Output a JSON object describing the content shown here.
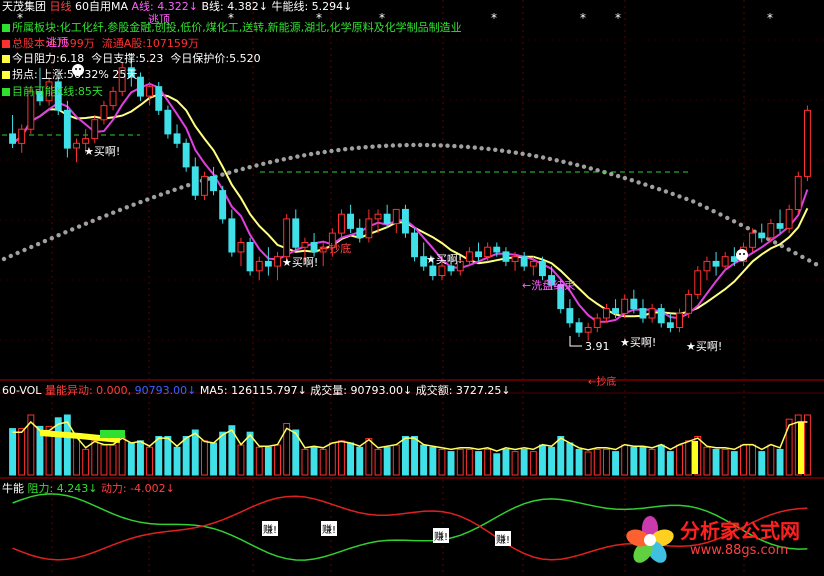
{
  "header": {
    "stock": "天茂集团",
    "period": "日线",
    "indicator": "60自用MA",
    "a_label": "A线:",
    "a_value": "4.322↓",
    "b_label": "B线:",
    "b_value": "4.382↓",
    "n_label": "牛能线:",
    "n_value": "5.294↓"
  },
  "info": {
    "sector": "所属板块:化工化纤,参股金融,创投,低价,煤化工,送转,新能源,湖北,化学原料及化学制品制造业",
    "total_cap": "总股本:47599万",
    "float_cap": "流通A股:107159万",
    "resist": "今日阻力:6.18",
    "support": "今日支撑:5.23",
    "protect": "今日保护价:5.520",
    "pivot": "拐点:",
    "up_pct": "上涨:56.32%",
    "days1": "25天",
    "cycle": "目前可能K线:85天"
  },
  "annotations": {
    "top1": "逃顶",
    "top2": "逃顶",
    "buy": "★买啊!",
    "bottom": "←抄底",
    "wash": "←洗盘结束",
    "low": "3.91",
    "bottom2": "←抄底"
  },
  "vol_header": {
    "name": "60-VOL",
    "abn_label": "量能异动:",
    "abn_value": "0.000,",
    "abn_value2": "90793.00↓",
    "ma5": "MA5: 126115.797↓",
    "volume": "成交量: 90793.00↓",
    "amount": "成交额: 3727.25↓"
  },
  "niu_header": {
    "name": "牛能",
    "resist_label": "阻力:",
    "resist_value": "4.243↓",
    "power_label": "动力:",
    "power_value": "-4.002↓",
    "earn": "赚!"
  },
  "logo": {
    "name": "分析家公式网",
    "url": "www.88gs.com"
  },
  "colors": {
    "up": "#ff3030",
    "down": "#40e0e8",
    "ma_a": "#ffff80",
    "ma_b": "#e040e0",
    "dots": "#a0a0a0",
    "green": "#30d030",
    "red": "#e02020"
  },
  "chart_data": {
    "type": "candlestick",
    "price_ylim": [
      3.6,
      7.2
    ],
    "candles": [
      [
        6.1,
        6.3,
        5.95,
        6.0
      ],
      [
        6.0,
        6.2,
        5.9,
        6.15
      ],
      [
        6.15,
        6.6,
        6.1,
        6.55
      ],
      [
        6.55,
        6.8,
        6.4,
        6.45
      ],
      [
        6.45,
        6.7,
        6.4,
        6.65
      ],
      [
        6.65,
        6.7,
        6.3,
        6.35
      ],
      [
        6.35,
        6.45,
        5.85,
        5.95
      ],
      [
        5.95,
        6.05,
        5.8,
        6.0
      ],
      [
        6.0,
        6.15,
        5.9,
        6.05
      ],
      [
        6.05,
        6.3,
        6.0,
        6.25
      ],
      [
        6.25,
        6.45,
        6.2,
        6.4
      ],
      [
        6.4,
        6.6,
        6.35,
        6.55
      ],
      [
        6.55,
        6.85,
        6.5,
        6.8
      ],
      [
        6.8,
        6.95,
        6.6,
        6.7
      ],
      [
        6.7,
        6.75,
        6.45,
        6.5
      ],
      [
        6.5,
        6.65,
        6.4,
        6.6
      ],
      [
        6.6,
        6.65,
        6.3,
        6.35
      ],
      [
        6.35,
        6.4,
        6.05,
        6.1
      ],
      [
        6.1,
        6.2,
        5.95,
        6.0
      ],
      [
        6.0,
        6.05,
        5.7,
        5.75
      ],
      [
        5.75,
        5.85,
        5.4,
        5.45
      ],
      [
        5.45,
        5.7,
        5.4,
        5.65
      ],
      [
        5.65,
        5.75,
        5.45,
        5.5
      ],
      [
        5.5,
        5.55,
        5.15,
        5.2
      ],
      [
        5.2,
        5.3,
        4.8,
        4.85
      ],
      [
        4.85,
        5.0,
        4.7,
        4.95
      ],
      [
        4.95,
        5.0,
        4.6,
        4.65
      ],
      [
        4.65,
        4.8,
        4.55,
        4.75
      ],
      [
        4.75,
        4.9,
        4.6,
        4.7
      ],
      [
        4.7,
        4.85,
        4.55,
        4.8
      ],
      [
        4.8,
        5.25,
        4.75,
        5.2
      ],
      [
        5.2,
        5.3,
        4.85,
        4.9
      ],
      [
        4.9,
        5.0,
        4.75,
        4.95
      ],
      [
        4.95,
        5.05,
        4.8,
        4.85
      ],
      [
        4.85,
        4.95,
        4.7,
        4.9
      ],
      [
        4.9,
        5.1,
        4.8,
        5.05
      ],
      [
        5.05,
        5.3,
        5.0,
        5.25
      ],
      [
        5.25,
        5.35,
        5.05,
        5.1
      ],
      [
        5.1,
        5.2,
        4.95,
        5.0
      ],
      [
        5.0,
        5.3,
        4.95,
        5.2
      ],
      [
        5.2,
        5.3,
        5.05,
        5.25
      ],
      [
        5.25,
        5.35,
        5.1,
        5.15
      ],
      [
        5.15,
        5.3,
        5.05,
        5.3
      ],
      [
        5.3,
        5.35,
        5.0,
        5.05
      ],
      [
        5.05,
        5.1,
        4.75,
        4.8
      ],
      [
        4.8,
        4.95,
        4.65,
        4.7
      ],
      [
        4.7,
        4.8,
        4.55,
        4.6
      ],
      [
        4.6,
        4.75,
        4.55,
        4.7
      ],
      [
        4.7,
        4.8,
        4.6,
        4.65
      ],
      [
        4.65,
        4.8,
        4.6,
        4.75
      ],
      [
        4.75,
        4.9,
        4.7,
        4.85
      ],
      [
        4.85,
        4.95,
        4.75,
        4.8
      ],
      [
        4.8,
        4.95,
        4.75,
        4.9
      ],
      [
        4.9,
        4.95,
        4.8,
        4.85
      ],
      [
        4.85,
        4.9,
        4.7,
        4.75
      ],
      [
        4.75,
        4.85,
        4.65,
        4.8
      ],
      [
        4.8,
        4.85,
        4.65,
        4.7
      ],
      [
        4.7,
        4.8,
        4.6,
        4.75
      ],
      [
        4.75,
        4.8,
        4.55,
        4.6
      ],
      [
        4.6,
        4.7,
        4.45,
        4.5
      ],
      [
        4.5,
        4.55,
        4.2,
        4.25
      ],
      [
        4.25,
        4.35,
        4.05,
        4.1
      ],
      [
        4.1,
        4.15,
        3.95,
        4.0
      ],
      [
        4.0,
        4.1,
        3.91,
        4.05
      ],
      [
        4.05,
        4.2,
        4.0,
        4.15
      ],
      [
        4.15,
        4.3,
        4.1,
        4.25
      ],
      [
        4.25,
        4.35,
        4.15,
        4.2
      ],
      [
        4.2,
        4.4,
        4.15,
        4.35
      ],
      [
        4.35,
        4.45,
        4.2,
        4.25
      ],
      [
        4.25,
        4.35,
        4.1,
        4.15
      ],
      [
        4.15,
        4.3,
        4.1,
        4.25
      ],
      [
        4.25,
        4.3,
        4.05,
        4.1
      ],
      [
        4.1,
        4.2,
        4.0,
        4.05
      ],
      [
        4.05,
        4.25,
        4.0,
        4.2
      ],
      [
        4.2,
        4.45,
        4.15,
        4.4
      ],
      [
        4.4,
        4.7,
        4.35,
        4.65
      ],
      [
        4.65,
        4.8,
        4.55,
        4.75
      ],
      [
        4.75,
        4.85,
        4.6,
        4.7
      ],
      [
        4.7,
        4.85,
        4.65,
        4.8
      ],
      [
        4.8,
        4.9,
        4.7,
        4.75
      ],
      [
        4.75,
        4.95,
        4.7,
        4.9
      ],
      [
        4.9,
        5.1,
        4.85,
        5.05
      ],
      [
        5.05,
        5.15,
        4.95,
        5.0
      ],
      [
        5.0,
        5.2,
        4.95,
        5.15
      ],
      [
        5.15,
        5.3,
        5.05,
        5.1
      ],
      [
        5.1,
        5.35,
        5.05,
        5.3
      ],
      [
        5.3,
        5.7,
        5.25,
        5.65
      ],
      [
        5.65,
        6.4,
        5.6,
        6.35
      ]
    ]
  }
}
